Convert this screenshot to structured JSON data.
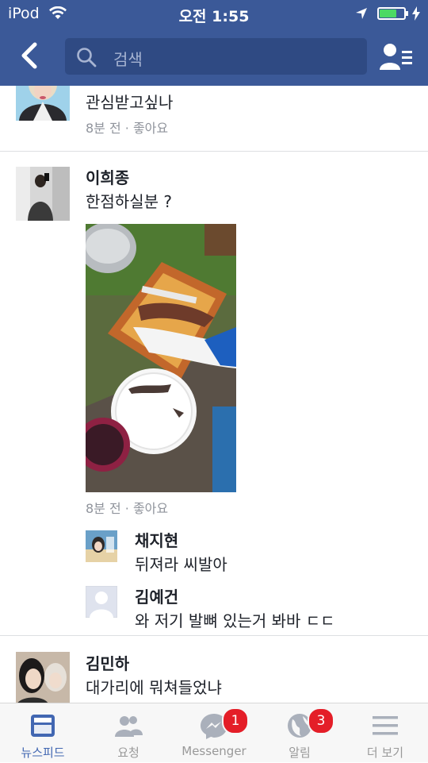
{
  "status_bar": {
    "carrier": "iPod",
    "time": "오전 1:55",
    "battery_percent": 70
  },
  "header": {
    "search_placeholder": "검색"
  },
  "comments": [
    {
      "text": "관심받고싶나",
      "meta": "8분 전 · 좋아요"
    },
    {
      "name": "이희종",
      "text": "한점하실분 ?",
      "meta": "8분 전 · 좋아요",
      "replies": [
        {
          "name": "채지현",
          "text": "뒤져라 씨발아"
        },
        {
          "name": "김예건",
          "text": "와 저기 발뼈 있는거 봐바 ㄷㄷ"
        }
      ]
    },
    {
      "name": "김민하",
      "text": "대가리에 뭐쳐들었냐"
    }
  ],
  "tabbar": {
    "tabs": [
      {
        "label": "뉴스피드",
        "icon": "newsfeed-icon",
        "active": true
      },
      {
        "label": "요청",
        "icon": "friend-requests-icon"
      },
      {
        "label": "Messenger",
        "icon": "messenger-icon",
        "badge": "1"
      },
      {
        "label": "알림",
        "icon": "notifications-globe-icon",
        "badge": "3"
      },
      {
        "label": "더 보기",
        "icon": "more-menu-icon"
      }
    ]
  },
  "colors": {
    "header": "#3b5998",
    "badge": "#e41e28",
    "active_tab": "#4267b2",
    "meta_text": "#90949c"
  }
}
